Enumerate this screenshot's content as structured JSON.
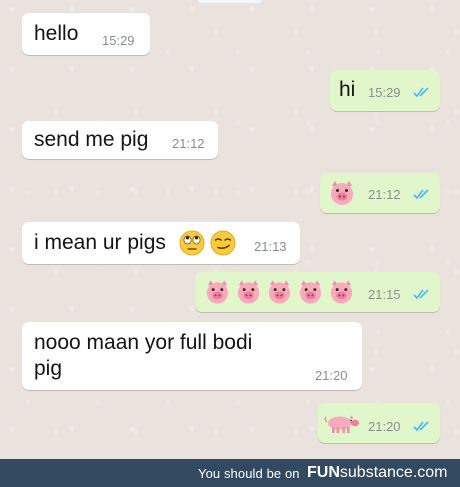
{
  "messages": [
    {
      "direction": "incoming",
      "text": "hello",
      "time": "15:29"
    },
    {
      "direction": "outgoing",
      "text": "hi",
      "time": "15:29",
      "status": "read"
    },
    {
      "direction": "incoming",
      "text": "send me pig",
      "time": "21:12"
    },
    {
      "direction": "outgoing",
      "emoji": [
        "pig-face"
      ],
      "time": "21:12",
      "status": "read"
    },
    {
      "direction": "incoming",
      "text": "i mean ur pigs",
      "emoji": [
        "face-with-rolling-eyes",
        "smirking-face"
      ],
      "time": "21:13"
    },
    {
      "direction": "outgoing",
      "emoji": [
        "pig-face",
        "pig-face",
        "pig-face",
        "pig-face",
        "pig-face"
      ],
      "time": "21:15",
      "status": "read"
    },
    {
      "direction": "incoming",
      "text_line1": "nooo maan yor full bodi",
      "text_line2": "pig",
      "time": "21:20"
    },
    {
      "direction": "outgoing",
      "emoji": [
        "pig"
      ],
      "time": "21:20",
      "status": "read"
    }
  ],
  "footer": {
    "prefix": "You should be on",
    "brand_bold": "FUN",
    "brand_rest": "substance.com"
  },
  "colors": {
    "incoming_bubble": "#ffffff",
    "outgoing_bubble": "#e1f6cb",
    "read_ticks": "#4fb6ec",
    "chat_background": "#eae2dd",
    "footer_background": "#32495f"
  }
}
